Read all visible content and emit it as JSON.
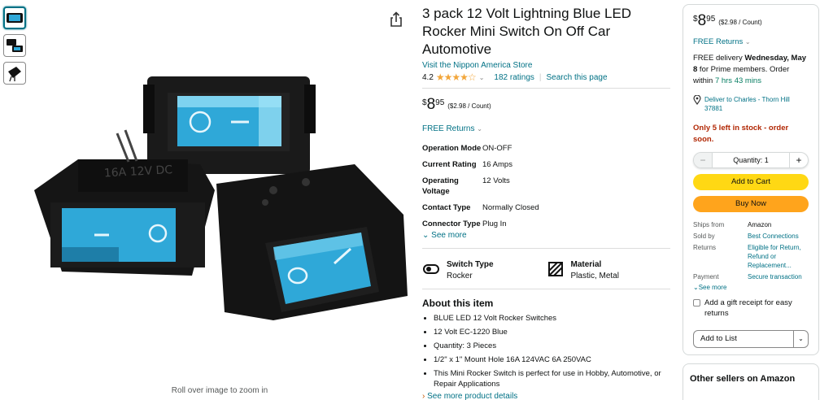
{
  "product": {
    "title": "3 pack 12 Volt Lightning Blue LED Rocker Mini Switch On Off Car Automotive",
    "store_link": "Visit the Nippon America Store",
    "rating_value": "4.2",
    "rating_stars": "★★★★☆",
    "ratings_count": "182 ratings",
    "search_link": "Search this page",
    "price_symbol": "$",
    "price_whole": "8",
    "price_fraction": "95",
    "price_unit": "($2.98 / Count)",
    "returns": "FREE Returns",
    "specs": [
      {
        "key": "Operation Mode",
        "value": "ON-OFF"
      },
      {
        "key": "Current Rating",
        "value": "16 Amps"
      },
      {
        "key": "Operating Voltage",
        "value": "12 Volts"
      },
      {
        "key": "Contact Type",
        "value": "Normally Closed"
      },
      {
        "key": "Connector Type",
        "value": "Plug In"
      }
    ],
    "see_more": "See more",
    "features": [
      {
        "title": "Switch Type",
        "value": "Rocker",
        "icon": "switch-type-icon"
      },
      {
        "title": "Material",
        "value": "Plastic, Metal",
        "icon": "material-icon"
      }
    ],
    "about_title": "About this item",
    "bullets": [
      "BLUE LED 12 Volt Rocker Switches",
      "12 Volt EC-1220 Blue",
      "Quantity: 3 Pieces",
      "1/2\" x 1\" Mount Hole 16A 124VAC 6A 250VAC",
      "This Mini Rocker Switch is perfect for use in Hobby, Automotive, or Repair Applications"
    ],
    "see_details": "See more product details",
    "zoom_hint": "Roll over image to zoom in"
  },
  "buybox": {
    "price_symbol": "$",
    "price_whole": "8",
    "price_fraction": "95",
    "price_unit": "($2.98 / Count)",
    "returns": "FREE Returns",
    "delivery_prefix": "FREE delivery ",
    "delivery_date": "Wednesday, May 8",
    "delivery_suffix": " for Prime members. Order within ",
    "delivery_countdown": "7 hrs 43 mins",
    "deliver_to": "Deliver to Charles - Thorn Hill 37881",
    "stock": "Only 5 left in stock - order soon.",
    "quantity_label": "Quantity: 1",
    "minus": "−",
    "plus": "+",
    "add_to_cart": "Add to Cart",
    "buy_now": "Buy Now",
    "info": [
      {
        "key": "Ships from",
        "value": "Amazon"
      },
      {
        "key": "Sold by",
        "value": "Best Connections"
      },
      {
        "key": "Returns",
        "value": "Eligible for Return, Refund or Replacement..."
      },
      {
        "key": "Payment",
        "value": "Secure transaction"
      }
    ],
    "see_more": "See more",
    "gift": "Add a gift receipt for easy returns",
    "add_to_list": "Add to List",
    "other_sellers": "Other sellers on Amazon"
  },
  "colors": {
    "link": "#007185",
    "star": "#F2A63B",
    "cart": "#FFD814",
    "buy": "#FFA41C",
    "stock": "#B12704",
    "switch_blue": "#2FA8D8"
  }
}
